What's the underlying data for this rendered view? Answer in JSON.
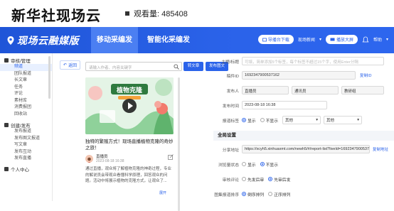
{
  "page": {
    "brand": "新华社现场云",
    "views_label": "观看量: 485408"
  },
  "appbar": {
    "logo": "现场云融媒版",
    "tabs": [
      "移动采编发",
      "智能化采编发"
    ],
    "pill_label": "导播台下载",
    "nav_label": "现场新闻",
    "screen_label": "播放大屏",
    "help_label": "帮助",
    "accent": "#2b63ea"
  },
  "sidebar": {
    "groups": [
      {
        "label": "审核/管理",
        "icon": "grid-icon",
        "items": [
          "频道",
          "团队报道",
          "长文章",
          "任务",
          "评论",
          "素材库",
          "消费报团",
          "回收站"
        ]
      },
      {
        "label": "创建/发布",
        "icon": "edit-icon",
        "items": [
          "发布报道",
          "发布图文报道",
          "写文章",
          "发布互动",
          "发布直播"
        ]
      },
      {
        "label": "个人中心",
        "icon": "user-icon",
        "items": []
      }
    ],
    "active_item": "频道"
  },
  "middle": {
    "back_label": "返回",
    "search_placeholder": "请输入作者、内容关键字",
    "btn_link": "转文章",
    "btn_publish": "发布图文",
    "thumb_title": "植物克隆",
    "post_title": "独特的繁殖方式！现场直播植物克隆的奇妙之旅！",
    "author_name": "直播员",
    "author_time": "2023-08-18 16:38",
    "post_body": "通过直播，观众将了解植物克隆的神奇过程，专业的解说员会带观众看懂科学原理，回答观众的问题。活动中将展示植物的克隆方式，让观众了...",
    "expand_label": "展开"
  },
  "form": {
    "title_label": "主题/标题",
    "title_placeholder": "可填，简单添加5个标签，每个标签不超过15个字，使用Enter分隔",
    "id_label": "稿件ID",
    "id_value": "1692347900537162",
    "copy_id": "复制ID",
    "people_label": "发布人",
    "people": [
      "直播员",
      "通讯员",
      "教研组"
    ],
    "time_label": "发布时间",
    "time_value": "2023-08-18 16:38",
    "display_label": "报道标签",
    "display_options": [
      "显示",
      "不显示"
    ],
    "display_sel1": "其他",
    "display_sel2": "其他",
    "section_title": "全局设置",
    "share_label": "分享地址",
    "share_value": "https://xcyh5.xinhuaxmt.com/newh5/#/report-list?liveId=1692347900537162",
    "copy_link": "复制地址",
    "browse_label": "浏览量状态",
    "browse_options": [
      "显示",
      "不显示"
    ],
    "review_label": "审核评论",
    "review_options": [
      "先发后审",
      "先审后发"
    ],
    "order_label": "图集报道排序",
    "order_options": [
      "倒序排列",
      "正序排列"
    ]
  }
}
